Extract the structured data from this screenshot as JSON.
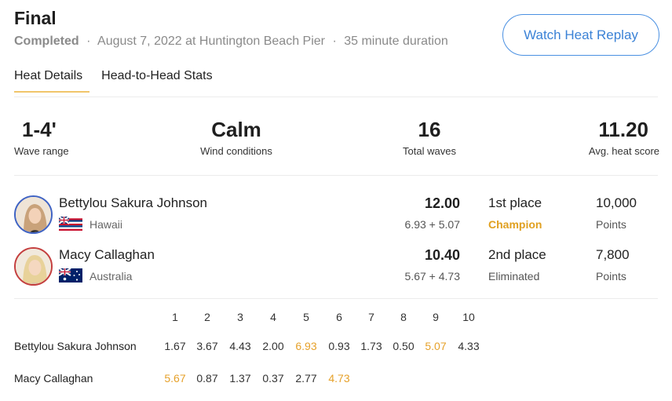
{
  "header": {
    "title": "Final",
    "status": "Completed",
    "separator": "·",
    "date_location": "August 7, 2022 at Huntington Beach Pier",
    "duration": "35 minute duration"
  },
  "replay_button": {
    "label": "Watch Heat Replay",
    "color": "#3b82d6"
  },
  "tabs": [
    {
      "label": "Heat Details",
      "active": true
    },
    {
      "label": "Head-to-Head Stats",
      "active": false
    }
  ],
  "stats": [
    {
      "value": "1-4'",
      "label": "Wave range"
    },
    {
      "value": "Calm",
      "label": "Wind conditions"
    },
    {
      "value": "16",
      "label": "Total waves"
    },
    {
      "value": "11.20",
      "label": "Avg. heat score"
    }
  ],
  "surfers": [
    {
      "name": "Bettylou Sakura Johnson",
      "country": "Hawaii",
      "flag_icon": "hawaii-flag-icon",
      "total": "12.00",
      "waves": "6.93 + 5.07",
      "place": "1st place",
      "result": "Champion",
      "points": "10,000",
      "points_label": "Points",
      "avatar_border": "#3f63c4"
    },
    {
      "name": "Macy Callaghan",
      "country": "Australia",
      "flag_icon": "australia-flag-icon",
      "total": "10.40",
      "waves": "5.67 + 4.73",
      "place": "2nd place",
      "result": "Eliminated",
      "points": "7,800",
      "points_label": "Points",
      "avatar_border": "#c43f3f"
    }
  ],
  "wave_table": {
    "columns": [
      "1",
      "2",
      "3",
      "4",
      "5",
      "6",
      "7",
      "8",
      "9",
      "10"
    ],
    "highlight_color": "#e6a12a",
    "rows": [
      {
        "name": "Bettylou Sakura Johnson",
        "scores": [
          "1.67",
          "3.67",
          "4.43",
          "2.00",
          "6.93",
          "0.93",
          "1.73",
          "0.50",
          "5.07",
          "4.33"
        ],
        "counting": [
          false,
          false,
          false,
          false,
          true,
          false,
          false,
          false,
          true,
          false
        ]
      },
      {
        "name": "Macy Callaghan",
        "scores": [
          "5.67",
          "0.87",
          "1.37",
          "0.37",
          "2.77",
          "4.73"
        ],
        "counting": [
          true,
          false,
          false,
          false,
          false,
          true
        ]
      }
    ]
  }
}
